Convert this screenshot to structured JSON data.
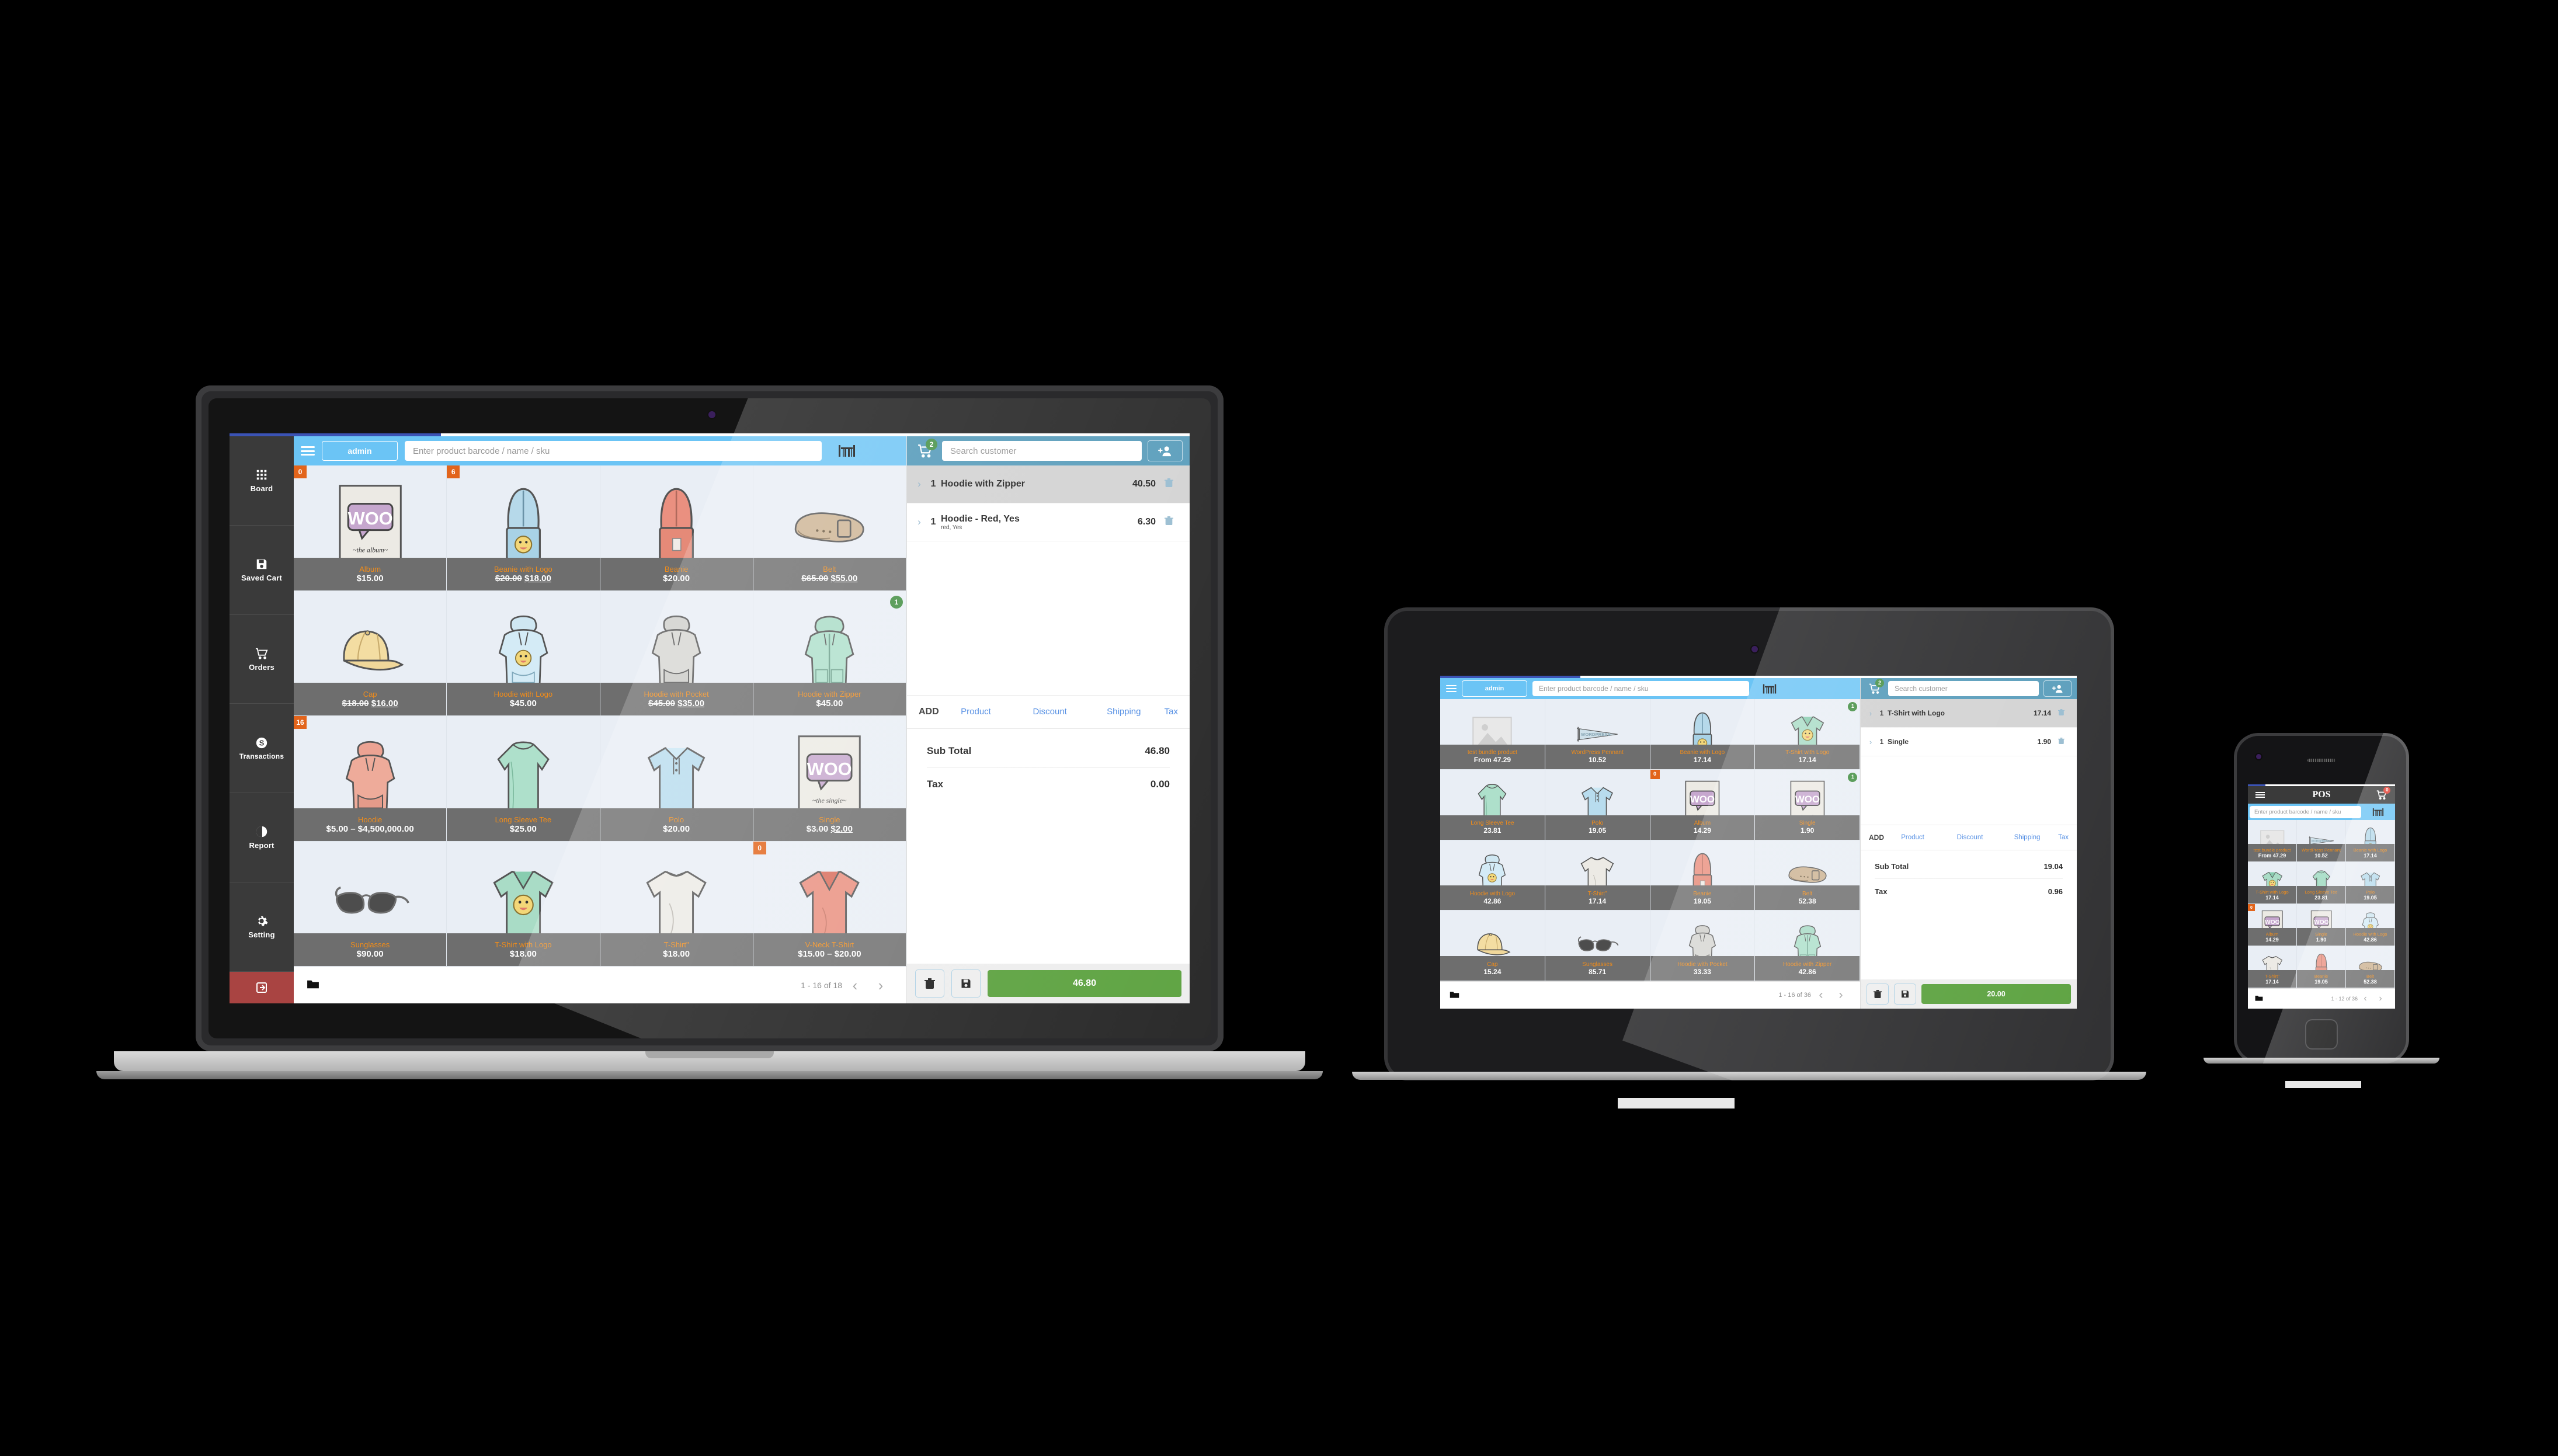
{
  "app": {
    "logo": "POS",
    "user_chip": "admin",
    "search_placeholder": "Enter product barcode / name / sku",
    "customer_placeholder": "Search customer",
    "scan_icon": "barcode-icon",
    "add_customer_icon": "add-user-icon",
    "menu_icon": "hamburger-icon",
    "cart_icon": "shopping-cart-icon",
    "folder_icon": "folder-icon",
    "prev_icon": "chevron-left-icon",
    "next_icon": "chevron-right-icon",
    "trash_icon": "trash-icon",
    "save_icon": "floppy-disk-icon",
    "accent_blue": "#6bc4f5",
    "cart_blue": "#4a94b5",
    "pay_green": "#4e9a2f",
    "name_orange": "#f08c1a",
    "badge_orange": "#e2641b",
    "badge_green": "#3e8c3e",
    "logout_red": "#a94442",
    "rail_dark": "#3a3a3a"
  },
  "sidebar": {
    "items": [
      {
        "label": "Board",
        "icon": "grid-icon"
      },
      {
        "label": "Saved Cart",
        "icon": "floppy-disk-icon"
      },
      {
        "label": "Orders",
        "icon": "shopping-cart-icon"
      },
      {
        "label": "Transactions",
        "icon": "dollar-circle-icon"
      },
      {
        "label": "Report",
        "icon": "pie-chart-icon"
      },
      {
        "label": "Setting",
        "icon": "gear-icon"
      }
    ],
    "logout": {
      "label": "",
      "icon": "logout-icon"
    }
  },
  "cart_panel": {
    "add_label": "ADD",
    "add_links": [
      "Product",
      "Discount",
      "Shipping",
      "Tax"
    ],
    "subtotal_label": "Sub Total",
    "tax_label": "Tax"
  },
  "laptop": {
    "cart_count": "2",
    "pagination": "1 - 16 of 18",
    "items": [
      {
        "qty": "1",
        "name": "Hoodie with Zipper",
        "variation": "",
        "price": "40.50",
        "selected": true
      },
      {
        "qty": "1",
        "name": "Hoodie - Red, Yes",
        "variation": "red, Yes",
        "price": "6.30",
        "selected": false
      }
    ],
    "subtotal": "46.80",
    "tax": "0.00",
    "total": "46.80",
    "products": [
      {
        "name": "Album",
        "price": "$15.00",
        "old": "",
        "badge": "0",
        "badge_type": "orange",
        "img": "album"
      },
      {
        "name": "Beanie with Logo",
        "price": "$18.00",
        "old": "$20.00",
        "badge": "6",
        "badge_type": "orange",
        "img": "beanie-blue"
      },
      {
        "name": "Beanie",
        "price": "$20.00",
        "old": "",
        "badge": "",
        "badge_type": "",
        "img": "beanie-red"
      },
      {
        "name": "Belt",
        "price": "$55.00",
        "old": "$65.00",
        "badge": "",
        "badge_type": "",
        "img": "belt"
      },
      {
        "name": "Cap",
        "price": "$16.00",
        "old": "$18.00",
        "badge": "",
        "badge_type": "",
        "img": "cap"
      },
      {
        "name": "Hoodie with Logo",
        "price": "$45.00",
        "old": "",
        "badge": "",
        "badge_type": "",
        "img": "hoodie-blue"
      },
      {
        "name": "Hoodie with Pocket",
        "price": "$35.00",
        "old": "$45.00",
        "badge": "",
        "badge_type": "",
        "img": "hoodie-gray"
      },
      {
        "name": "Hoodie with Zipper",
        "price": "$45.00",
        "old": "",
        "badge": "1",
        "badge_type": "green",
        "img": "hoodie-green"
      },
      {
        "name": "Hoodie",
        "price": "$5.00 – $4,500,000.00",
        "old": "",
        "badge": "16",
        "badge_type": "orange",
        "img": "hoodie-red"
      },
      {
        "name": "Long Sleeve Tee",
        "price": "$25.00",
        "old": "",
        "badge": "",
        "badge_type": "",
        "img": "longsleeve"
      },
      {
        "name": "Polo",
        "price": "$20.00",
        "old": "",
        "badge": "",
        "badge_type": "",
        "img": "polo"
      },
      {
        "name": "Single",
        "price": "$2.00",
        "old": "$3.00",
        "badge": "",
        "badge_type": "",
        "img": "single"
      },
      {
        "name": "Sunglasses",
        "price": "$90.00",
        "old": "",
        "badge": "",
        "badge_type": "",
        "img": "sunglasses"
      },
      {
        "name": "T-Shirt with Logo",
        "price": "$18.00",
        "old": "",
        "badge": "",
        "badge_type": "",
        "img": "tshirt-logo"
      },
      {
        "name": "T-Shirt\"",
        "price": "$18.00",
        "old": "",
        "badge": "",
        "badge_type": "",
        "img": "tshirt-white"
      },
      {
        "name": "V-Neck T-Shirt",
        "price": "$15.00 – $20.00",
        "old": "",
        "badge": "0",
        "badge_type": "orange",
        "img": "vneck-red"
      }
    ]
  },
  "tablet": {
    "cart_count": "2",
    "pagination": "1 - 16 of 36",
    "items": [
      {
        "qty": "1",
        "name": "T-Shirt with Logo",
        "variation": "",
        "price": "17.14",
        "selected": true
      },
      {
        "qty": "1",
        "name": "Single",
        "variation": "",
        "price": "1.90",
        "selected": false
      }
    ],
    "subtotal": "19.04",
    "tax": "0.96",
    "total": "20.00",
    "products": [
      {
        "name": "test bundle product",
        "price": "From 47.29",
        "old": "",
        "badge": "",
        "badge_type": "",
        "img": "placeholder"
      },
      {
        "name": "WordPress Pennant",
        "price": "10.52",
        "old": "",
        "badge": "",
        "badge_type": "",
        "img": "pennant"
      },
      {
        "name": "Beanie with Logo",
        "price": "17.14",
        "old": "",
        "badge": "",
        "badge_type": "",
        "img": "beanie-blue"
      },
      {
        "name": "T-Shirt with Logo",
        "price": "17.14",
        "old": "",
        "badge": "1",
        "badge_type": "green",
        "img": "tshirt-logo"
      },
      {
        "name": "Long Sleeve Tee",
        "price": "23.81",
        "old": "",
        "badge": "",
        "badge_type": "",
        "img": "longsleeve"
      },
      {
        "name": "Polo",
        "price": "19.05",
        "old": "",
        "badge": "",
        "badge_type": "",
        "img": "polo"
      },
      {
        "name": "Album",
        "price": "14.29",
        "old": "",
        "badge": "0",
        "badge_type": "orange",
        "img": "album"
      },
      {
        "name": "Single",
        "price": "1.90",
        "old": "",
        "badge": "1",
        "badge_type": "green",
        "img": "single"
      },
      {
        "name": "Hoodie with Logo",
        "price": "42.86",
        "old": "",
        "badge": "",
        "badge_type": "",
        "img": "hoodie-blue"
      },
      {
        "name": "T-Shirt\"",
        "price": "17.14",
        "old": "",
        "badge": "",
        "badge_type": "",
        "img": "tshirt-white"
      },
      {
        "name": "Beanie",
        "price": "19.05",
        "old": "",
        "badge": "",
        "badge_type": "",
        "img": "beanie-red"
      },
      {
        "name": "Belt",
        "price": "52.38",
        "old": "",
        "badge": "",
        "badge_type": "",
        "img": "belt"
      },
      {
        "name": "Cap",
        "price": "15.24",
        "old": "",
        "badge": "",
        "badge_type": "",
        "img": "cap"
      },
      {
        "name": "Sunglasses",
        "price": "85.71",
        "old": "",
        "badge": "",
        "badge_type": "",
        "img": "sunglasses"
      },
      {
        "name": "Hoodie with Pocket",
        "price": "33.33",
        "old": "",
        "badge": "",
        "badge_type": "",
        "img": "hoodie-gray"
      },
      {
        "name": "Hoodie with Zipper",
        "price": "42.86",
        "old": "",
        "badge": "",
        "badge_type": "",
        "img": "hoodie-green"
      }
    ]
  },
  "phone": {
    "title": "POS",
    "cart_count": "0",
    "pagination": "1 - 12 of 36",
    "products": [
      {
        "name": "test bundle product",
        "price": "From 47.29",
        "badge": "",
        "badge_type": "",
        "img": "placeholder"
      },
      {
        "name": "WordPress Pennant",
        "price": "10.52",
        "badge": "",
        "badge_type": "",
        "img": "pennant"
      },
      {
        "name": "Beanie with Logo",
        "price": "17.14",
        "badge": "",
        "badge_type": "",
        "img": "beanie-blue"
      },
      {
        "name": "T-Shirt with Logo",
        "price": "17.14",
        "badge": "",
        "badge_type": "",
        "img": "tshirt-logo"
      },
      {
        "name": "Long Sleeve Tee",
        "price": "23.81",
        "badge": "",
        "badge_type": "",
        "img": "longsleeve"
      },
      {
        "name": "Polo",
        "price": "19.05",
        "badge": "",
        "badge_type": "",
        "img": "polo"
      },
      {
        "name": "Album",
        "price": "14.29",
        "badge": "0",
        "badge_type": "orange",
        "img": "album"
      },
      {
        "name": "Single",
        "price": "1.90",
        "badge": "",
        "badge_type": "",
        "img": "single"
      },
      {
        "name": "Hoodie with Logo",
        "price": "42.86",
        "badge": "",
        "badge_type": "",
        "img": "hoodie-blue"
      },
      {
        "name": "T-Shirt\"",
        "price": "17.14",
        "badge": "",
        "badge_type": "",
        "img": "tshirt-white"
      },
      {
        "name": "Beanie",
        "price": "19.05",
        "badge": "",
        "badge_type": "",
        "img": "beanie-red"
      },
      {
        "name": "Belt",
        "price": "52.38",
        "badge": "",
        "badge_type": "",
        "img": "belt"
      }
    ]
  }
}
